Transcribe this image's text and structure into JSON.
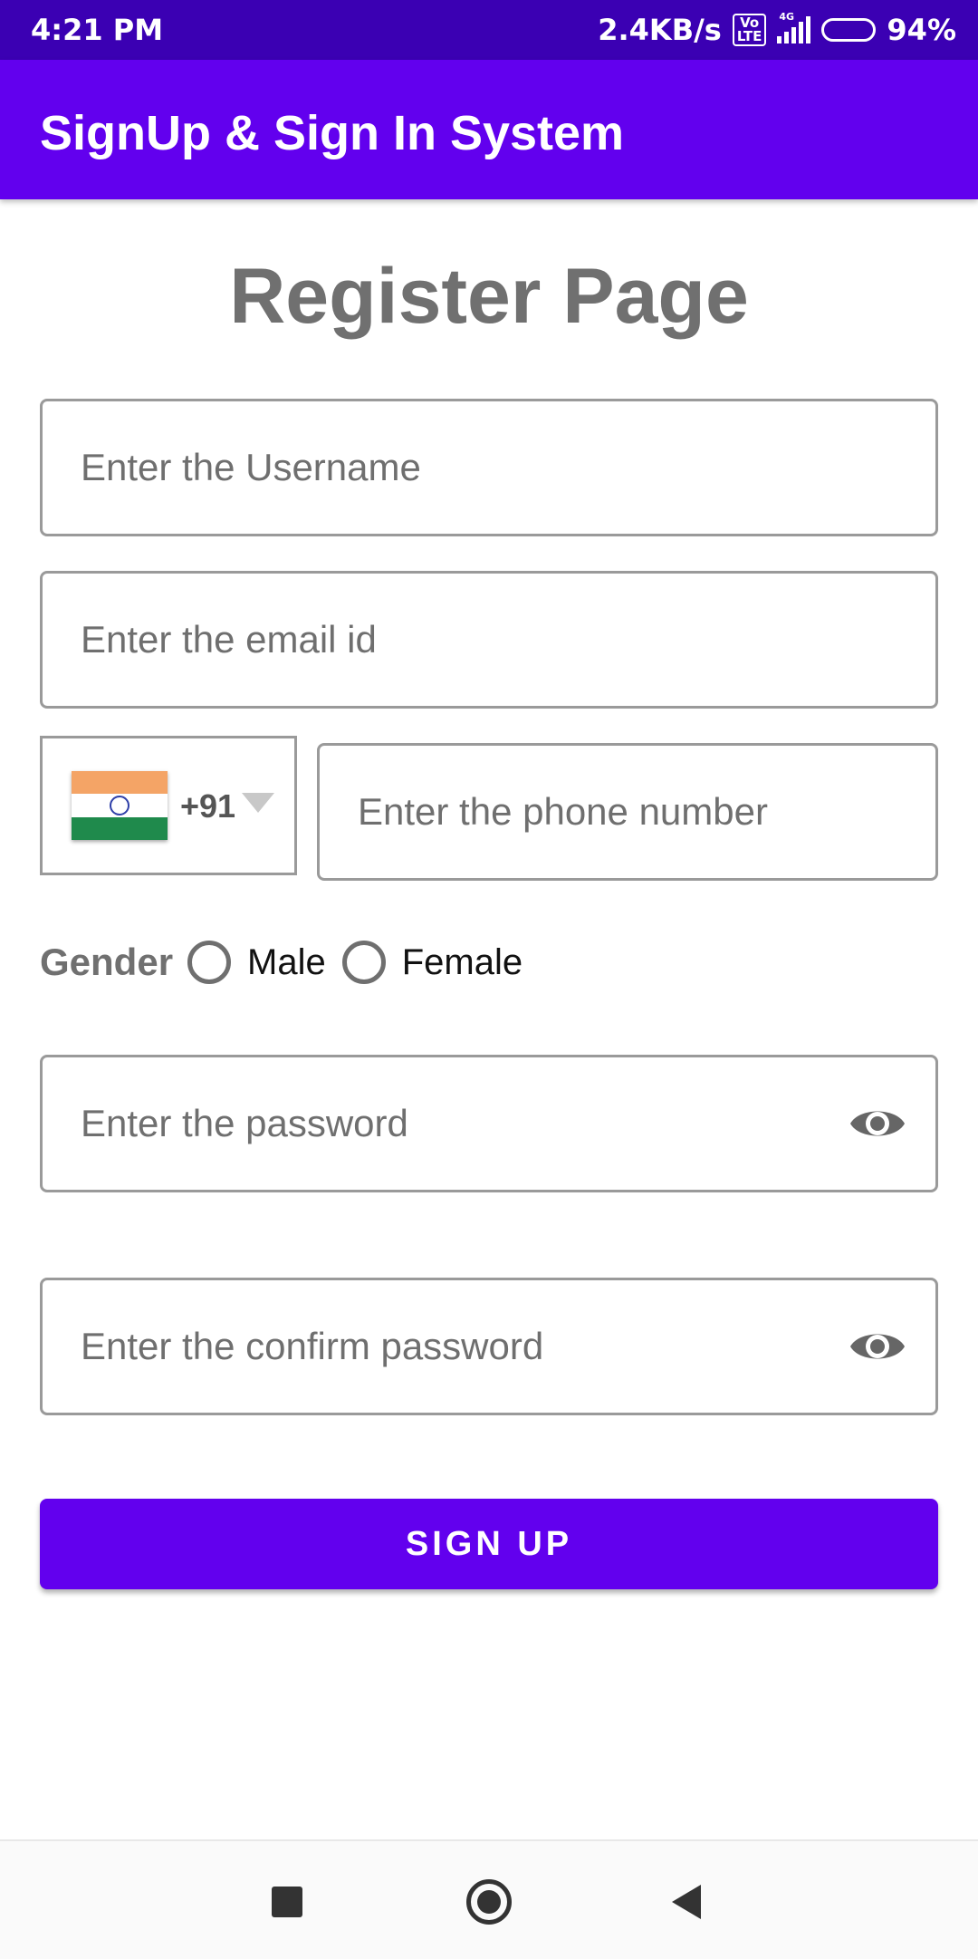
{
  "status_bar": {
    "time": "4:21 PM",
    "net_speed": "2.4KB/s",
    "volte": "Vo LTE",
    "network": "4G",
    "battery": "94%",
    "battery_level": 0.94
  },
  "app_bar": {
    "title": "SignUp & Sign In System"
  },
  "page": {
    "title": "Register Page"
  },
  "form": {
    "username": {
      "placeholder": "Enter the Username",
      "value": ""
    },
    "email": {
      "placeholder": "Enter the email id",
      "value": ""
    },
    "country_code": {
      "flag": "india-flag-icon",
      "code": "+91"
    },
    "phone": {
      "placeholder": "Enter the phone number",
      "value": ""
    },
    "gender": {
      "label": "Gender",
      "options": [
        "Male",
        "Female"
      ],
      "selected": null
    },
    "password": {
      "placeholder": "Enter the password",
      "value": "",
      "toggle_icon": "eye-icon"
    },
    "confirm_password": {
      "placeholder": "Enter the confirm password",
      "value": "",
      "toggle_icon": "eye-icon"
    },
    "submit_label": "SIGN UP"
  },
  "colors": {
    "status_bar": "#3b00b3",
    "primary": "#6200ee",
    "title_gray": "#707070"
  },
  "nav_bar": {
    "icons": [
      "recents-square-icon",
      "home-circle-icon",
      "back-triangle-icon"
    ]
  }
}
